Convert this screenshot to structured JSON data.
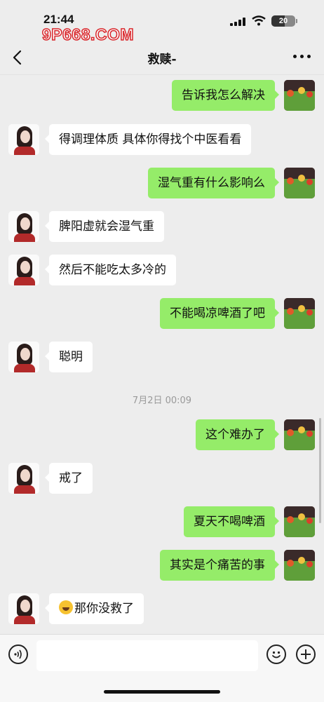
{
  "status_bar": {
    "time": "21:44",
    "battery": "20"
  },
  "watermark": "9P668.COM",
  "header": {
    "title": "救赎-"
  },
  "messages": [
    {
      "side": "out",
      "text": "告诉我怎么解决"
    },
    {
      "side": "in",
      "text": "得调理体质 具体你得找个中医看看"
    },
    {
      "side": "out",
      "text": "湿气重有什么影响么"
    },
    {
      "side": "in",
      "text": "脾阳虚就会湿气重"
    },
    {
      "side": "in",
      "text": "然后不能吃太多冷的"
    },
    {
      "side": "out",
      "text": "不能喝凉啤酒了吧"
    },
    {
      "side": "in",
      "text": "聪明"
    },
    {
      "side": "out",
      "text": "这个难办了"
    },
    {
      "side": "in",
      "text": "戒了"
    },
    {
      "side": "out",
      "text": "夏天不喝啤酒"
    },
    {
      "side": "out",
      "text": "其实是个痛苦的事"
    },
    {
      "side": "in",
      "text": "那你没救了",
      "emoji": "laughing-tears"
    }
  ],
  "timestamp": "7月2日 00:09",
  "input": {
    "value": "",
    "placeholder": ""
  },
  "colors": {
    "outgoing_bubble": "#95ec69",
    "incoming_bubble": "#ffffff",
    "background": "#ededed"
  }
}
